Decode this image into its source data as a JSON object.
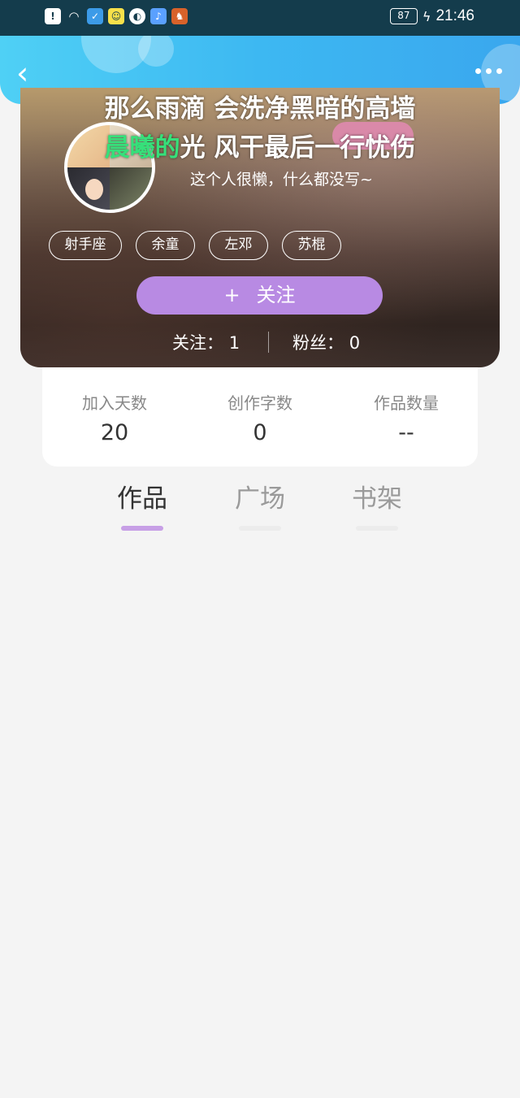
{
  "status_bar": {
    "battery": "87",
    "time": "21:46",
    "icons": [
      "alert-icon",
      "wifi-icon",
      "shield-icon",
      "app-icon",
      "ball-icon",
      "music-icon",
      "game-icon"
    ]
  },
  "header": {
    "back_label": "‹",
    "more_label": "more"
  },
  "overlay": {
    "line1": "那么雨滴 会洗净黑暗的高墙",
    "line2_highlight": "晨曦的",
    "line2_rest": "光 风干最后一行忧伤"
  },
  "profile": {
    "bio": "这个人很懒，什么都没写~",
    "tags": [
      "射手座",
      "余童",
      "左邓",
      "苏棍"
    ],
    "follow_button": "关注",
    "follow_plus": "+",
    "following_label": "关注：",
    "following_count": "1",
    "fans_label": "粉丝：",
    "fans_count": "0"
  },
  "stats": [
    {
      "label": "加入天数",
      "value": "20"
    },
    {
      "label": "创作字数",
      "value": "0"
    },
    {
      "label": "作品数量",
      "value": "--"
    }
  ],
  "tabs": [
    {
      "label": "作品",
      "active": true
    },
    {
      "label": "广场",
      "active": false
    },
    {
      "label": "书架",
      "active": false
    }
  ],
  "colors": {
    "header_gradient_start": "#4fd0f5",
    "header_gradient_end": "#3aa7ee",
    "follow_button": "#b88ae3",
    "active_tab_underline": "#c79fe6",
    "lyric_highlight": "#36e07a"
  }
}
